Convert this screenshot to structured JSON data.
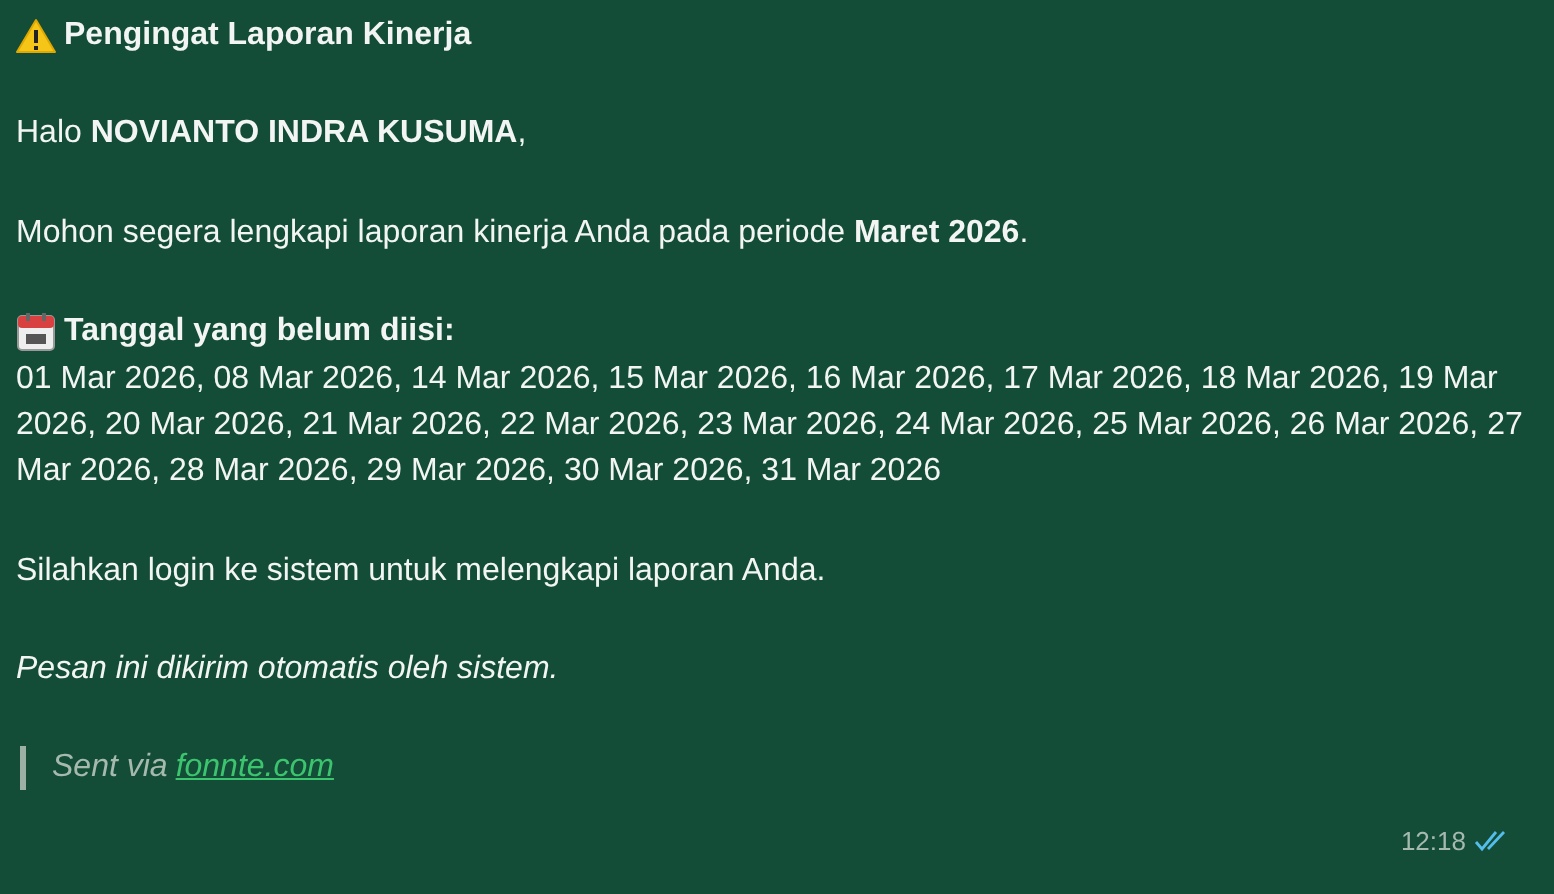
{
  "title": {
    "text": "Pengingat Laporan Kinerja"
  },
  "greeting": "Halo **NOVIANTO INDRA KUSUMA**,",
  "request": "Mohon segera lengkapi laporan kinerja Anda pada periode **Maret 2026**.",
  "missing_dates": {
    "heading": "Tanggal yang belum diisi:",
    "dates": "01 Mar 2026, 08 Mar 2026, 14 Mar 2026, 15 Mar 2026, 16 Mar 2026, 17 Mar 2026, 18 Mar 2026, 19 Mar 2026, 20 Mar 2026, 21 Mar 2026, 22 Mar 2026, 23 Mar 2026, 24 Mar 2026, 25 Mar 2026, 26 Mar 2026, 27 Mar 2026, 28 Mar 2026, 29 Mar 2026, 30 Mar 2026, 31 Mar 2026"
  },
  "instruction": "Silahkan login ke sistem untuk melengkapi laporan Anda.",
  "footer_note": "Pesan ini dikirim otomatis oleh sistem.",
  "quote": {
    "text": "Sent via",
    "link": "fonnte.com"
  },
  "time": "12:18",
  "read": true
}
